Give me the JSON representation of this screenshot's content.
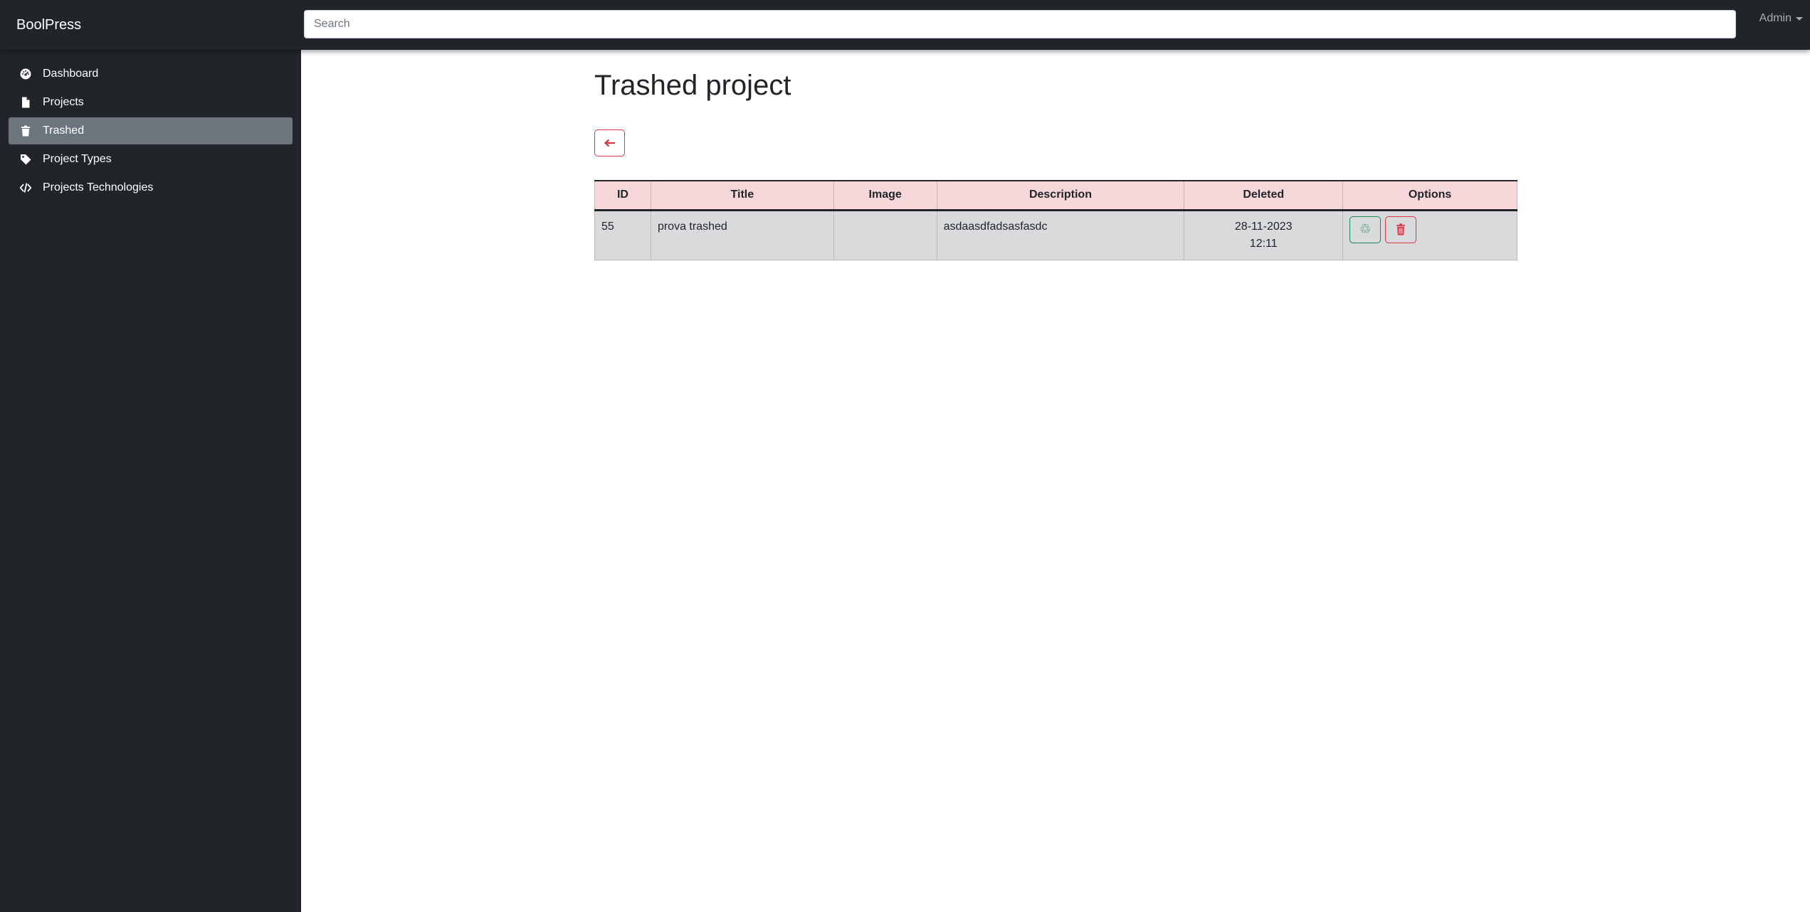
{
  "topbar": {
    "brand": "BoolPress",
    "search_placeholder": "Search",
    "user_label": "Admin"
  },
  "sidebar": {
    "items": [
      {
        "label": "Dashboard",
        "icon": "gauge-icon",
        "active": false
      },
      {
        "label": "Projects",
        "icon": "file-icon",
        "active": false
      },
      {
        "label": "Trashed",
        "icon": "trash-icon",
        "active": true
      },
      {
        "label": "Project Types",
        "icon": "tag-icon",
        "active": false
      },
      {
        "label": "Projects Technologies",
        "icon": "code-icon",
        "active": false
      }
    ]
  },
  "main": {
    "title": "Trashed project",
    "back_icon": "arrow-left-icon",
    "table": {
      "headers": [
        "ID",
        "Title",
        "Image",
        "Description",
        "Deleted",
        "Options"
      ],
      "rows": [
        {
          "id": "55",
          "title": "prova trashed",
          "image": "",
          "description": "asdaasdfadsasfasdc",
          "deleted_date": "28-11-2023",
          "deleted_time": "12:11",
          "restore_icon": "recycle-icon",
          "delete_icon": "trash-icon"
        }
      ]
    }
  },
  "colors": {
    "sidebar_bg": "#212529",
    "active_item_bg": "#6c757d",
    "header_row_bg": "#f8d7da",
    "data_row_bg": "#d9dadc",
    "danger": "#dc3545",
    "success": "#198754"
  }
}
